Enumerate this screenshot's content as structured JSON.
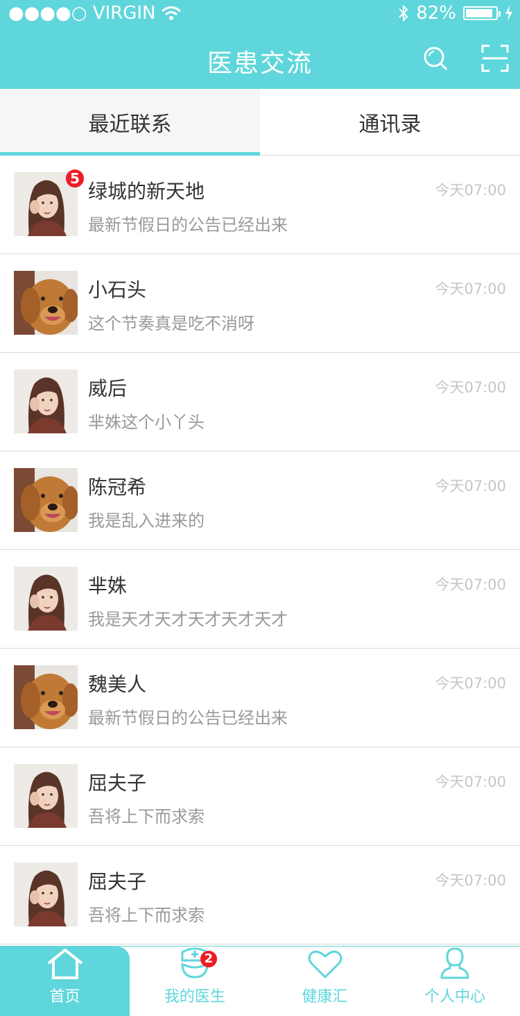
{
  "status": {
    "carrier": "●●●●○ VIRGIN",
    "battery": "82%"
  },
  "header": {
    "title": "医患交流"
  },
  "tabs": [
    {
      "label": "最近联系",
      "active": true
    },
    {
      "label": "通讯录",
      "active": false
    }
  ],
  "contacts": [
    {
      "name": "绿城的新天地",
      "preview": "最新节假日的公告已经出来",
      "time": "今天07:00",
      "avatar": "woman-avatar",
      "badge": "5"
    },
    {
      "name": "小石头",
      "preview": "这个节奏真是吃不消呀",
      "time": "今天07:00",
      "avatar": "dog-avatar"
    },
    {
      "name": "威后",
      "preview": "芈姝这个小丫头",
      "time": "今天07:00",
      "avatar": "woman-avatar"
    },
    {
      "name": "陈冠希",
      "preview": "我是乱入进来的",
      "time": "今天07:00",
      "avatar": "dog-avatar"
    },
    {
      "name": "芈姝",
      "preview": "我是天才天才天才天才天才",
      "time": "今天07:00",
      "avatar": "woman-avatar"
    },
    {
      "name": "魏美人",
      "preview": "最新节假日的公告已经出来",
      "time": "今天07:00",
      "avatar": "dog-avatar"
    },
    {
      "name": "屈夫子",
      "preview": "吾将上下而求索",
      "time": "今天07:00",
      "avatar": "woman-avatar"
    },
    {
      "name": "屈夫子",
      "preview": "吾将上下而求索",
      "time": "今天07:00",
      "avatar": "woman-avatar"
    }
  ],
  "tabbar": [
    {
      "label": "首页",
      "icon": "home-icon",
      "active": true
    },
    {
      "label": "我的医生",
      "icon": "doctor-icon",
      "badge": "2"
    },
    {
      "label": "健康汇",
      "icon": "heart-icon"
    },
    {
      "label": "个人中心",
      "icon": "person-icon"
    }
  ],
  "colors": {
    "accent": "#5fd6db",
    "badge": "#ee1c24"
  }
}
